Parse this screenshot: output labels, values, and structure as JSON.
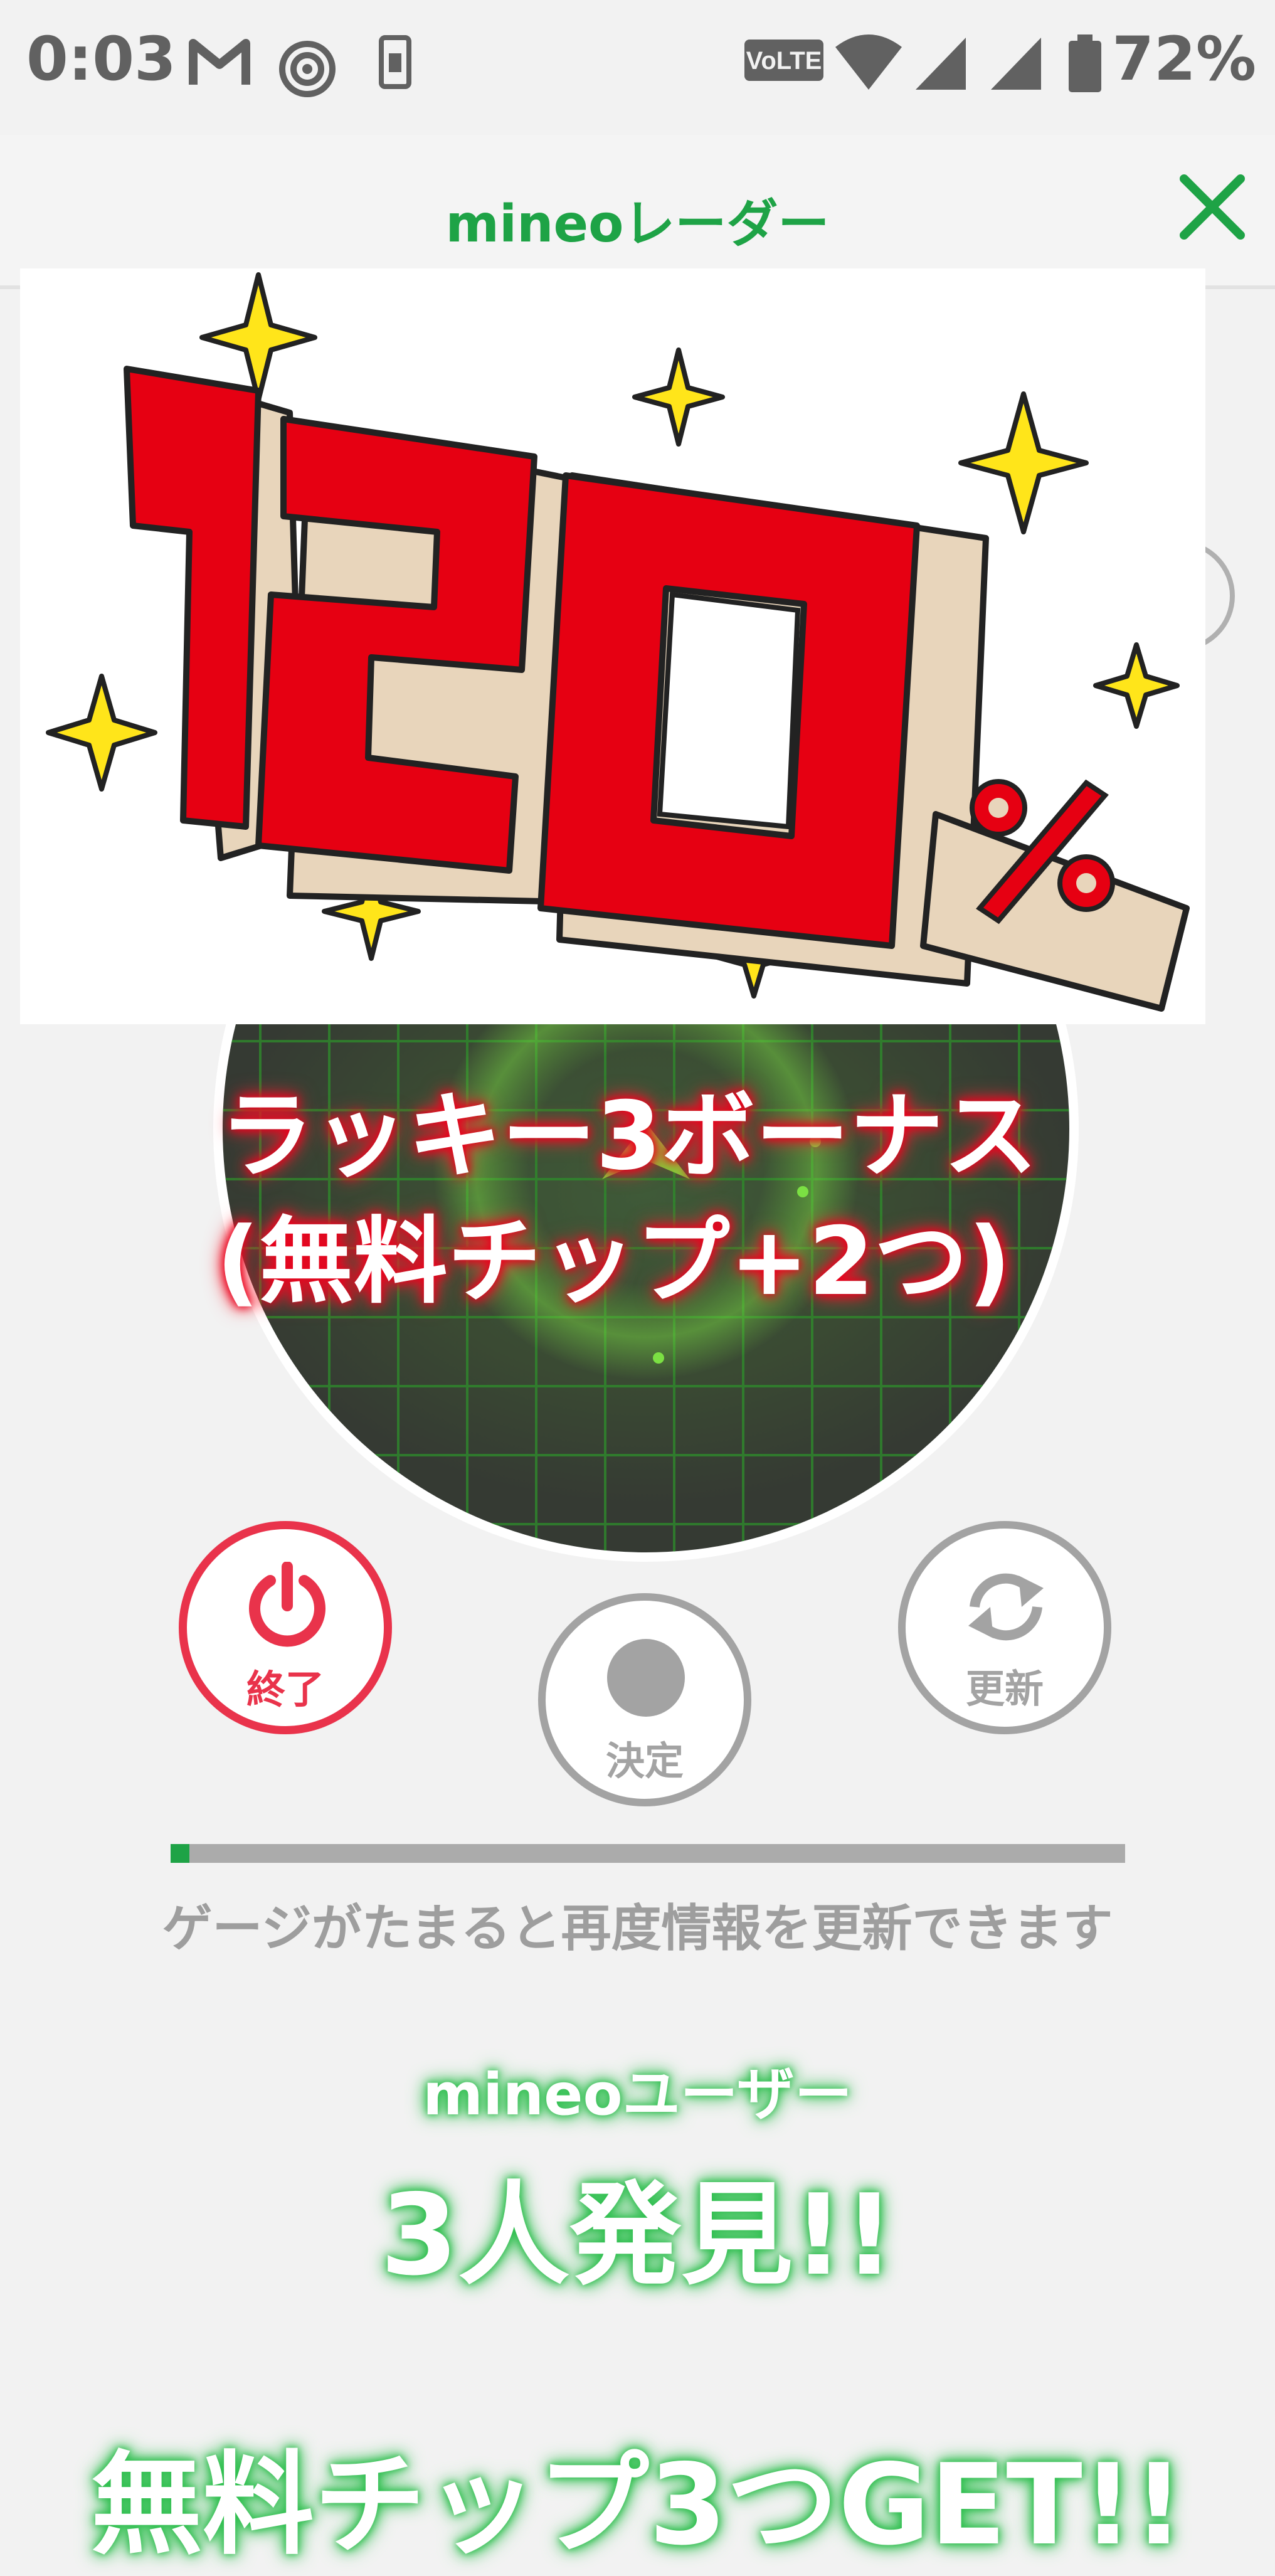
{
  "status_bar": {
    "time": "0:03",
    "battery": "72%",
    "network_badge": "VoLTE",
    "icons": [
      "gmail-icon",
      "hotspot-icon",
      "phone-icon",
      "volte-icon",
      "wifi-icon",
      "signal-icon",
      "signal-icon",
      "battery-icon"
    ]
  },
  "header": {
    "title": "mineoレーダー",
    "close_icon": "close-icon"
  },
  "banner": {
    "number": "120",
    "unit": "%"
  },
  "radar": {
    "bonus_line1": "ラッキー3ボーナス",
    "bonus_line2": "(無料チップ+2つ)"
  },
  "buttons": {
    "end": {
      "label": "終了",
      "icon": "power-icon"
    },
    "decide": {
      "label": "決定",
      "icon": "dot-icon"
    },
    "refresh": {
      "label": "更新",
      "icon": "refresh-icon"
    }
  },
  "gauge": {
    "progress": 0.02,
    "caption": "ゲージがたまると再度情報を更新できます"
  },
  "result": {
    "users_label": "mineoユーザー",
    "found": "3人発見!!",
    "reward": "無料チップ3つGET!!"
  },
  "colors": {
    "accent_green": "#1ea346",
    "end_red": "#e9334b",
    "banner_red": "#e60012",
    "inactive_gray": "#a3a3a3"
  }
}
